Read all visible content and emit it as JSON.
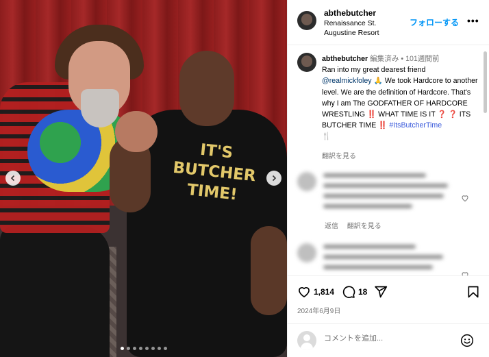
{
  "photo": {
    "shirt_lines": [
      "IT'S",
      "BUTCHER",
      "TIME!"
    ],
    "slide_count": 8,
    "active_slide": 1
  },
  "post": {
    "username": "abthebutcher",
    "location": "Renaissance St. Augustine Resort",
    "follow_label": "フォローする",
    "more_label": "•••"
  },
  "caption": {
    "username": "abthebutcher",
    "edited": "編集済み",
    "separator": "•",
    "age": "101週間前",
    "text_1": "Ran into my great dearest friend",
    "mention": "@realmickfoley",
    "emoji_1": "🙏",
    "text_2": "We took Hardcore to another level. We are the definition of Hardcore. That's why I am The GODFATHER OF HARDCORE WRESTLING",
    "emoji_2": "‼️",
    "text_3": "WHAT TIME IS IT",
    "emoji_3": "❓ ❓",
    "text_4": "ITS BUTCHER TIME",
    "emoji_4": "‼️",
    "hashtag": "#ItsButcherTime",
    "emoji_5": "🍴",
    "translate_label": "翻訳を見る"
  },
  "comments": {
    "reply_label": "返信",
    "translate_label": "翻訳を見る"
  },
  "actions": {
    "like_count": "1,814",
    "comment_count": "18",
    "date": "2024年6月9日"
  },
  "composer": {
    "placeholder": "コメントを追加..."
  }
}
